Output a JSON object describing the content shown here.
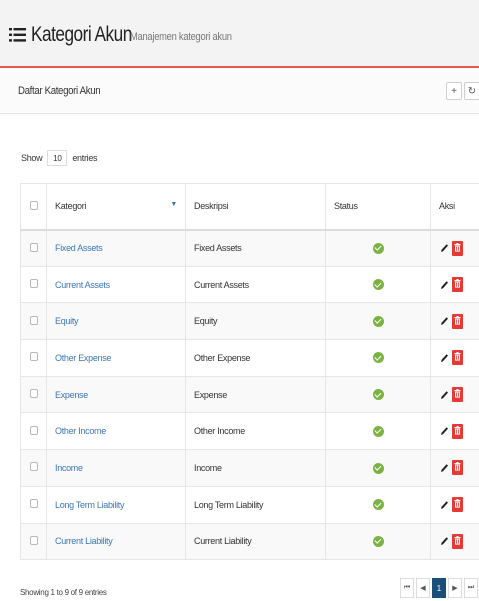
{
  "header": {
    "title": "Kategori Akun",
    "subtitle": "Manajemen kategori akun"
  },
  "panel": {
    "title": "Daftar Kategori Akun",
    "add_symbol": "+",
    "refresh_symbol": "↻"
  },
  "length_menu": {
    "prefix": "Show",
    "value": "10",
    "suffix": "entries"
  },
  "table": {
    "columns": [
      "Kategori",
      "Deskripsi",
      "Status",
      "Aksi"
    ],
    "rows": [
      {
        "kategori": "Fixed Assets",
        "deskripsi": "Fixed Assets",
        "status": "active"
      },
      {
        "kategori": "Current Assets",
        "deskripsi": "Current Assets",
        "status": "active"
      },
      {
        "kategori": "Equity",
        "deskripsi": "Equity",
        "status": "active"
      },
      {
        "kategori": "Other Expense",
        "deskripsi": "Other Expense",
        "status": "active"
      },
      {
        "kategori": "Expense",
        "deskripsi": "Expense",
        "status": "active"
      },
      {
        "kategori": "Other Income",
        "deskripsi": "Other Income",
        "status": "active"
      },
      {
        "kategori": "Income",
        "deskripsi": "Income",
        "status": "active"
      },
      {
        "kategori": "Long Term Liability",
        "deskripsi": "Long Term Liability",
        "status": "active"
      },
      {
        "kategori": "Current Liability",
        "deskripsi": "Current Liability",
        "status": "active"
      }
    ]
  },
  "footer": {
    "info": "Showing 1 to 9 of 9 entries",
    "pager": {
      "first": "⏮",
      "prev": "◀",
      "current": "1",
      "next": "▶",
      "last": "⏭"
    }
  },
  "colors": {
    "accent_line": "#e8594b",
    "link": "#3c77b8",
    "status_ok": "#7bb342",
    "delete": "#e53935",
    "pager_active": "#1a4f7a"
  },
  "icons": {
    "title": "list-icon",
    "add": "plus-icon",
    "refresh": "refresh-icon",
    "status": "check-circle-icon",
    "edit": "pencil-icon",
    "delete": "trash-icon"
  }
}
